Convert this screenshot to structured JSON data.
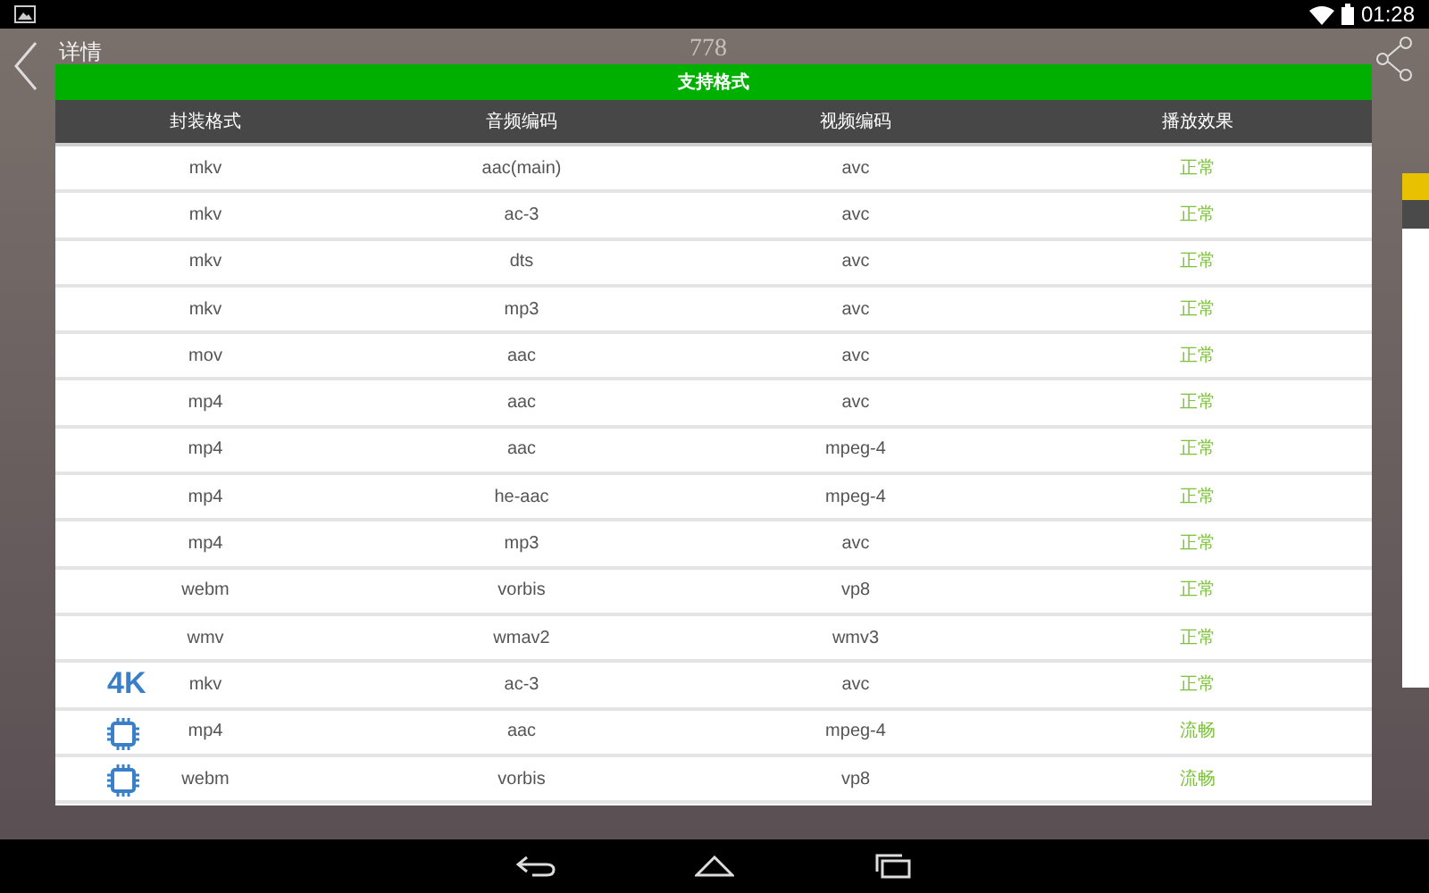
{
  "status_bar": {
    "time": "01:28"
  },
  "header": {
    "back_label": "详情",
    "title": "778"
  },
  "dialog": {
    "title": "支持格式",
    "columns": [
      "封装格式",
      "音频编码",
      "视频编码",
      "播放效果"
    ],
    "rows": [
      {
        "container": "mkv",
        "audio": "aac(main)",
        "video": "avc",
        "result": "正常"
      },
      {
        "container": "mkv",
        "audio": "ac-3",
        "video": "avc",
        "result": "正常"
      },
      {
        "container": "mkv",
        "audio": "dts",
        "video": "avc",
        "result": "正常"
      },
      {
        "container": "mkv",
        "audio": "mp3",
        "video": "avc",
        "result": "正常"
      },
      {
        "container": "mov",
        "audio": "aac",
        "video": "avc",
        "result": "正常"
      },
      {
        "container": "mp4",
        "audio": "aac",
        "video": "avc",
        "result": "正常"
      },
      {
        "container": "mp4",
        "audio": "aac",
        "video": "mpeg-4",
        "result": "正常"
      },
      {
        "container": "mp4",
        "audio": "he-aac",
        "video": "mpeg-4",
        "result": "正常"
      },
      {
        "container": "mp4",
        "audio": "mp3",
        "video": "avc",
        "result": "正常"
      },
      {
        "container": "webm",
        "audio": "vorbis",
        "video": "vp8",
        "result": "正常"
      },
      {
        "container": "wmv",
        "audio": "wmav2",
        "video": "wmv3",
        "result": "正常"
      },
      {
        "container": "mkv",
        "audio": "ac-3",
        "video": "avc",
        "result": "正常",
        "badge": {
          "kind": "text",
          "label": "4K"
        }
      },
      {
        "container": "mp4",
        "audio": "aac",
        "video": "mpeg-4",
        "result": "流畅",
        "badge": {
          "kind": "chip"
        }
      },
      {
        "container": "webm",
        "audio": "vorbis",
        "video": "vp8",
        "result": "流畅",
        "badge": {
          "kind": "chip"
        }
      }
    ]
  }
}
